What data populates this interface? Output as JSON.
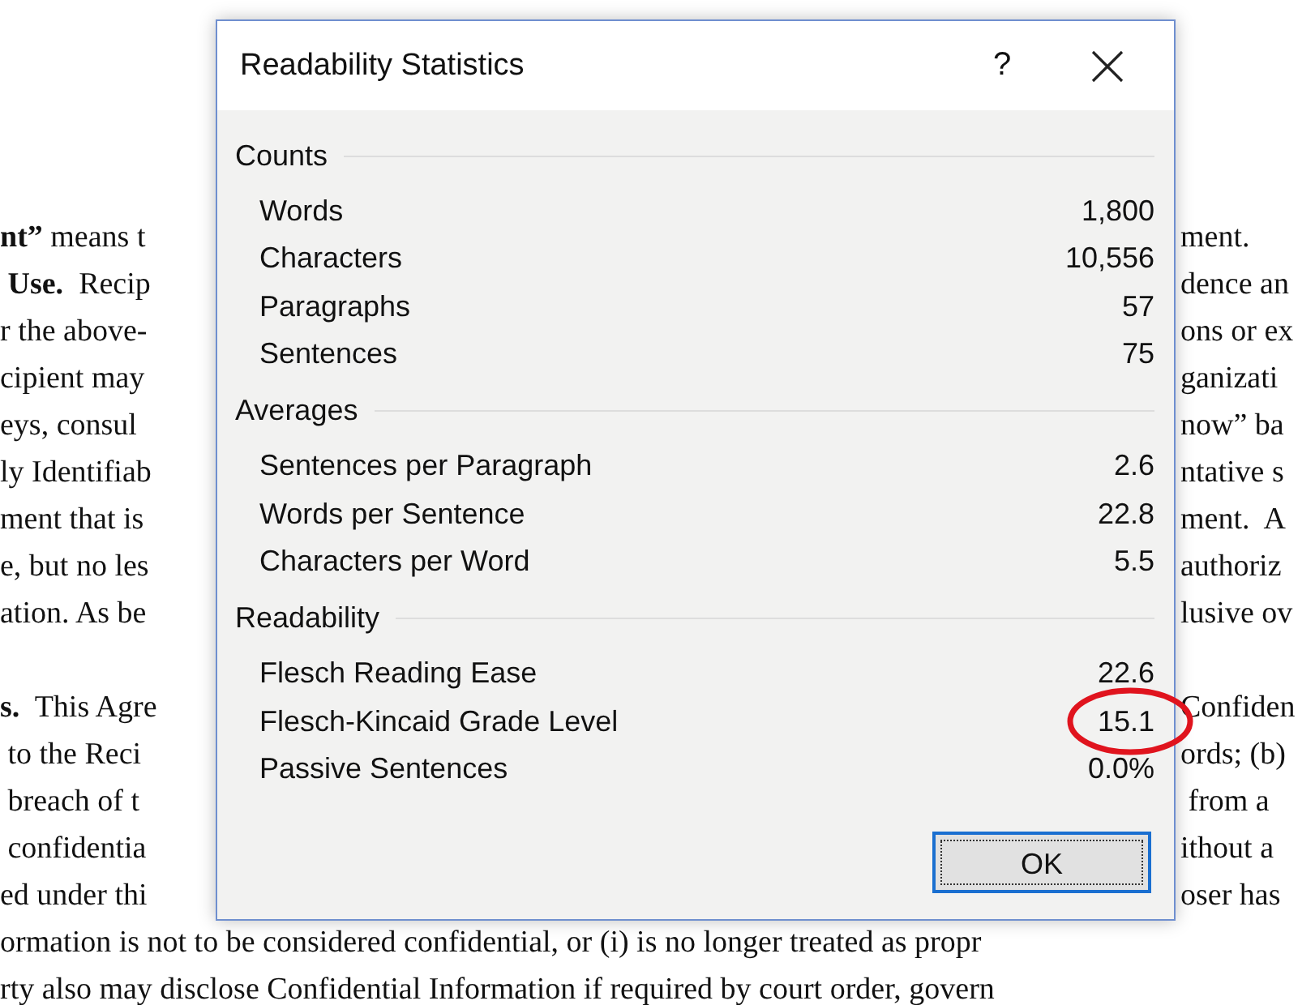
{
  "document": {
    "lines": [
      {
        "kind": "split",
        "paragraph_break": false,
        "left": "**nt”** means t",
        "right": "ment."
      },
      {
        "kind": "split",
        "paragraph_break": false,
        "left": " **Use.**  Recip",
        "right": "dence an"
      },
      {
        "kind": "split",
        "paragraph_break": false,
        "left": "r the above-",
        "right": "ons or ex"
      },
      {
        "kind": "split",
        "paragraph_break": false,
        "left": "cipient may",
        "right": "ganizati"
      },
      {
        "kind": "split",
        "paragraph_break": false,
        "left": "eys, consul",
        "right": "now” ba"
      },
      {
        "kind": "split",
        "paragraph_break": false,
        "left": "ly Identifiab",
        "right": "ntative s"
      },
      {
        "kind": "split",
        "paragraph_break": false,
        "left": "ment that is",
        "right": "ment.  A"
      },
      {
        "kind": "split",
        "paragraph_break": false,
        "left": "e, but no les",
        "right": "authoriz"
      },
      {
        "kind": "split",
        "paragraph_break": false,
        "left": "ation. As be",
        "right": "lusive ov"
      },
      {
        "kind": "split",
        "paragraph_break": true,
        "left": "**s.**  This Agre",
        "right": "Confiden"
      },
      {
        "kind": "split",
        "paragraph_break": false,
        "left": " to the Reci",
        "right": "ords; (b)"
      },
      {
        "kind": "split",
        "paragraph_break": false,
        "left": " breach of t",
        "right": " from a"
      },
      {
        "kind": "split",
        "paragraph_break": false,
        "left": " confidentia",
        "right": "ithout a"
      },
      {
        "kind": "split",
        "paragraph_break": false,
        "left": "ed under thi",
        "right": "oser has"
      },
      {
        "kind": "full",
        "paragraph_break": false,
        "text": "ormation is not to be considered confidential, or (i) is no longer treated as propr"
      },
      {
        "kind": "full",
        "paragraph_break": false,
        "text": "rty also may disclose Confidential Information if required by court order, govern"
      }
    ]
  },
  "dialog": {
    "title": "Readability Statistics",
    "help_button": "?",
    "sections": [
      {
        "title": "Counts",
        "rows": [
          {
            "label": "Words",
            "value": "1,800",
            "circled": false
          },
          {
            "label": "Characters",
            "value": "10,556",
            "circled": false
          },
          {
            "label": "Paragraphs",
            "value": "57",
            "circled": false
          },
          {
            "label": "Sentences",
            "value": "75",
            "circled": false
          }
        ]
      },
      {
        "title": "Averages",
        "rows": [
          {
            "label": "Sentences per Paragraph",
            "value": "2.6",
            "circled": false
          },
          {
            "label": "Words per Sentence",
            "value": "22.8",
            "circled": false
          },
          {
            "label": "Characters per Word",
            "value": "5.5",
            "circled": false
          }
        ]
      },
      {
        "title": "Readability",
        "rows": [
          {
            "label": "Flesch Reading Ease",
            "value": "22.6",
            "circled": false
          },
          {
            "label": "Flesch-Kincaid Grade Level",
            "value": "15.1",
            "circled": true
          },
          {
            "label": "Passive Sentences",
            "value": "0.0%",
            "circled": false
          }
        ]
      }
    ],
    "buttons": [
      {
        "label": "OK",
        "default": true
      }
    ]
  }
}
